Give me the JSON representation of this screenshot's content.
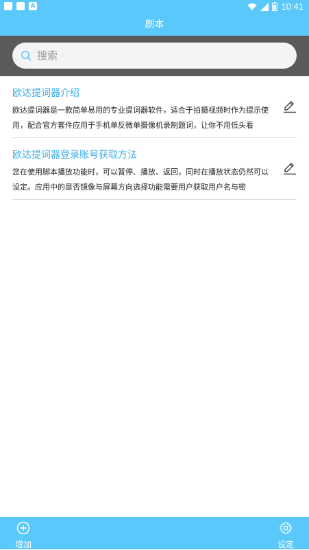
{
  "status_bar": {
    "time": "10:41"
  },
  "header": {
    "title": "剧本"
  },
  "search": {
    "placeholder": "搜索"
  },
  "scripts": [
    {
      "title": "欧达提词器介绍",
      "preview": "欧达提词器是一款简单易用的专业提词器软件，适合于拍摄视频时作为提示使用，配合官方套件应用于手机单反微单摄像机录制题词，让你不用低头看"
    },
    {
      "title": "欧达提词器登录账号获取方法",
      "preview": "您在使用脚本播放功能时，可以暂停、播放、返回，同时在播放状态仍然可以设定。应用中的是否镜像与屏幕方向选择功能需要用户获取用户名与密"
    }
  ],
  "bottom_nav": {
    "add_label": "增加",
    "settings_label": "设定"
  },
  "colors": {
    "accent": "#5ac8fa",
    "search_band": "#5a5a5a",
    "title_text": "#3aaee6"
  },
  "icons": [
    "search-icon",
    "edit-icon",
    "add-circle-icon",
    "gear-icon",
    "wifi-icon",
    "signal-icon",
    "battery-icon"
  ]
}
